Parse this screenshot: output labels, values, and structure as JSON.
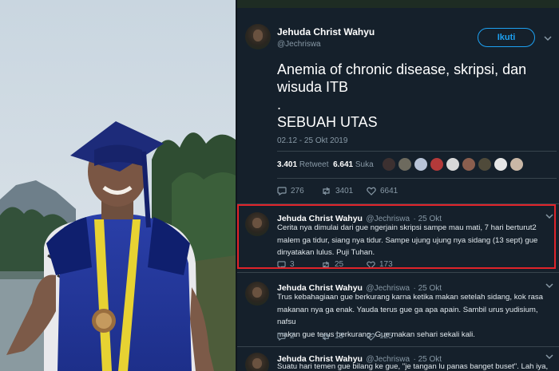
{
  "tweet": {
    "author_name": "Jehuda Christ Wahyu",
    "author_handle": "@Jechriswa",
    "follow_label": "Ikuti",
    "text_line1": "Anemia of chronic disease, skripsi, dan",
    "text_line2": "wisuda ITB",
    "text_dot": ".",
    "text_line3": "SEBUAH UTAS",
    "timestamp": "02.12 - 25 Okt 2019",
    "retweets_count": "3.401",
    "retweets_label": "Retweet",
    "likes_count": "6.641",
    "likes_label": "Suka",
    "reply_count": "276",
    "retweet_action_count": "3401",
    "like_action_count": "6641"
  },
  "replies": [
    {
      "name": "Jehuda Christ Wahyu",
      "handle": "@Jechriswa",
      "time": "· 25 Okt",
      "line1": "Cerita nya dimulai dari gue ngerjain skripsi sampe mau mati, 7 hari berturut2",
      "line2": "malem ga tidur, siang nya tidur. Sampe ujung ujung nya sidang (13 sept) gue",
      "line3": "dinyatakan lulus. Puji Tuhan.",
      "reply_count": "3",
      "retweet_count": "25",
      "like_count": "173"
    },
    {
      "name": "Jehuda Christ Wahyu",
      "handle": "@Jechriswa",
      "time": "· 25 Okt",
      "line1": "Trus kebahagiaan gue berkurang karna ketika makan setelah sidang, kok rasa",
      "line2": "makanan nya ga enak. Yauda terus gue ga apa apain. Sambil urus yudisium, nafsu",
      "line3": "makan gue terus berkurang. Gue makan sehari sekali kali.",
      "reply_count": "2",
      "retweet_count": "18",
      "like_count": "125"
    },
    {
      "name": "Jehuda Christ Wahyu",
      "handle": "@Jechriswa",
      "time": "· 25 Okt",
      "line1": "Suatu hari temen gue bilang ke gue, \"je tangan lu panas banget buset\". Lah iya,"
    }
  ],
  "colors": {
    "background": "#15202b",
    "accent": "#1da1f2",
    "muted": "#8899a6",
    "highlight_border": "#e0232a"
  }
}
